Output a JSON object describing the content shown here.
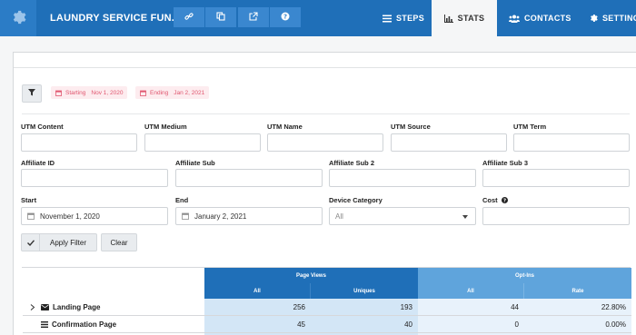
{
  "header": {
    "title": "LAUNDRY SERVICE FUN...",
    "nav": [
      {
        "label": "STEPS",
        "icon": "list-icon"
      },
      {
        "label": "STATS",
        "icon": "bar-chart-icon"
      },
      {
        "label": "CONTACTS",
        "icon": "users-icon"
      },
      {
        "label": "SETTINGS",
        "icon": "gear-icon"
      }
    ],
    "active_tab": "STATS",
    "accent": "#1f6fb8"
  },
  "date_badges": {
    "starting_label": "Starting",
    "starting_value": "Nov 1, 2020",
    "ending_label": "Ending",
    "ending_value": "Jan 2, 2021"
  },
  "filters": {
    "utm_content": {
      "label": "UTM Content",
      "value": ""
    },
    "utm_medium": {
      "label": "UTM Medium",
      "value": ""
    },
    "utm_name": {
      "label": "UTM Name",
      "value": ""
    },
    "utm_source": {
      "label": "UTM Source",
      "value": ""
    },
    "utm_term": {
      "label": "UTM Term",
      "value": ""
    },
    "affiliate_id": {
      "label": "Affiliate ID",
      "value": ""
    },
    "affiliate_sub": {
      "label": "Affiliate Sub",
      "value": ""
    },
    "affiliate_sub2": {
      "label": "Affiliate Sub 2",
      "value": ""
    },
    "affiliate_sub3": {
      "label": "Affiliate Sub 3",
      "value": ""
    },
    "start": {
      "label": "Start",
      "value": "November 1, 2020"
    },
    "end": {
      "label": "End",
      "value": "January 2, 2021"
    },
    "device_category": {
      "label": "Device Category",
      "value": "All"
    },
    "cost": {
      "label": "Cost",
      "value": ""
    }
  },
  "buttons": {
    "apply": "Apply Filter",
    "clear": "Clear"
  },
  "table": {
    "group_headers": [
      "Page Views",
      "Opt-Ins"
    ],
    "sub_headers": [
      "All",
      "Uniques",
      "All",
      "Rate"
    ],
    "rows": [
      {
        "name": "Landing Page",
        "icon": "envelope-icon",
        "expandable": true,
        "values": [
          "256",
          "193",
          "44",
          "22.80%"
        ]
      },
      {
        "name": "Confirmation Page",
        "icon": "list-icon",
        "expandable": false,
        "values": [
          "45",
          "40",
          "0",
          "0.00%"
        ]
      }
    ]
  }
}
